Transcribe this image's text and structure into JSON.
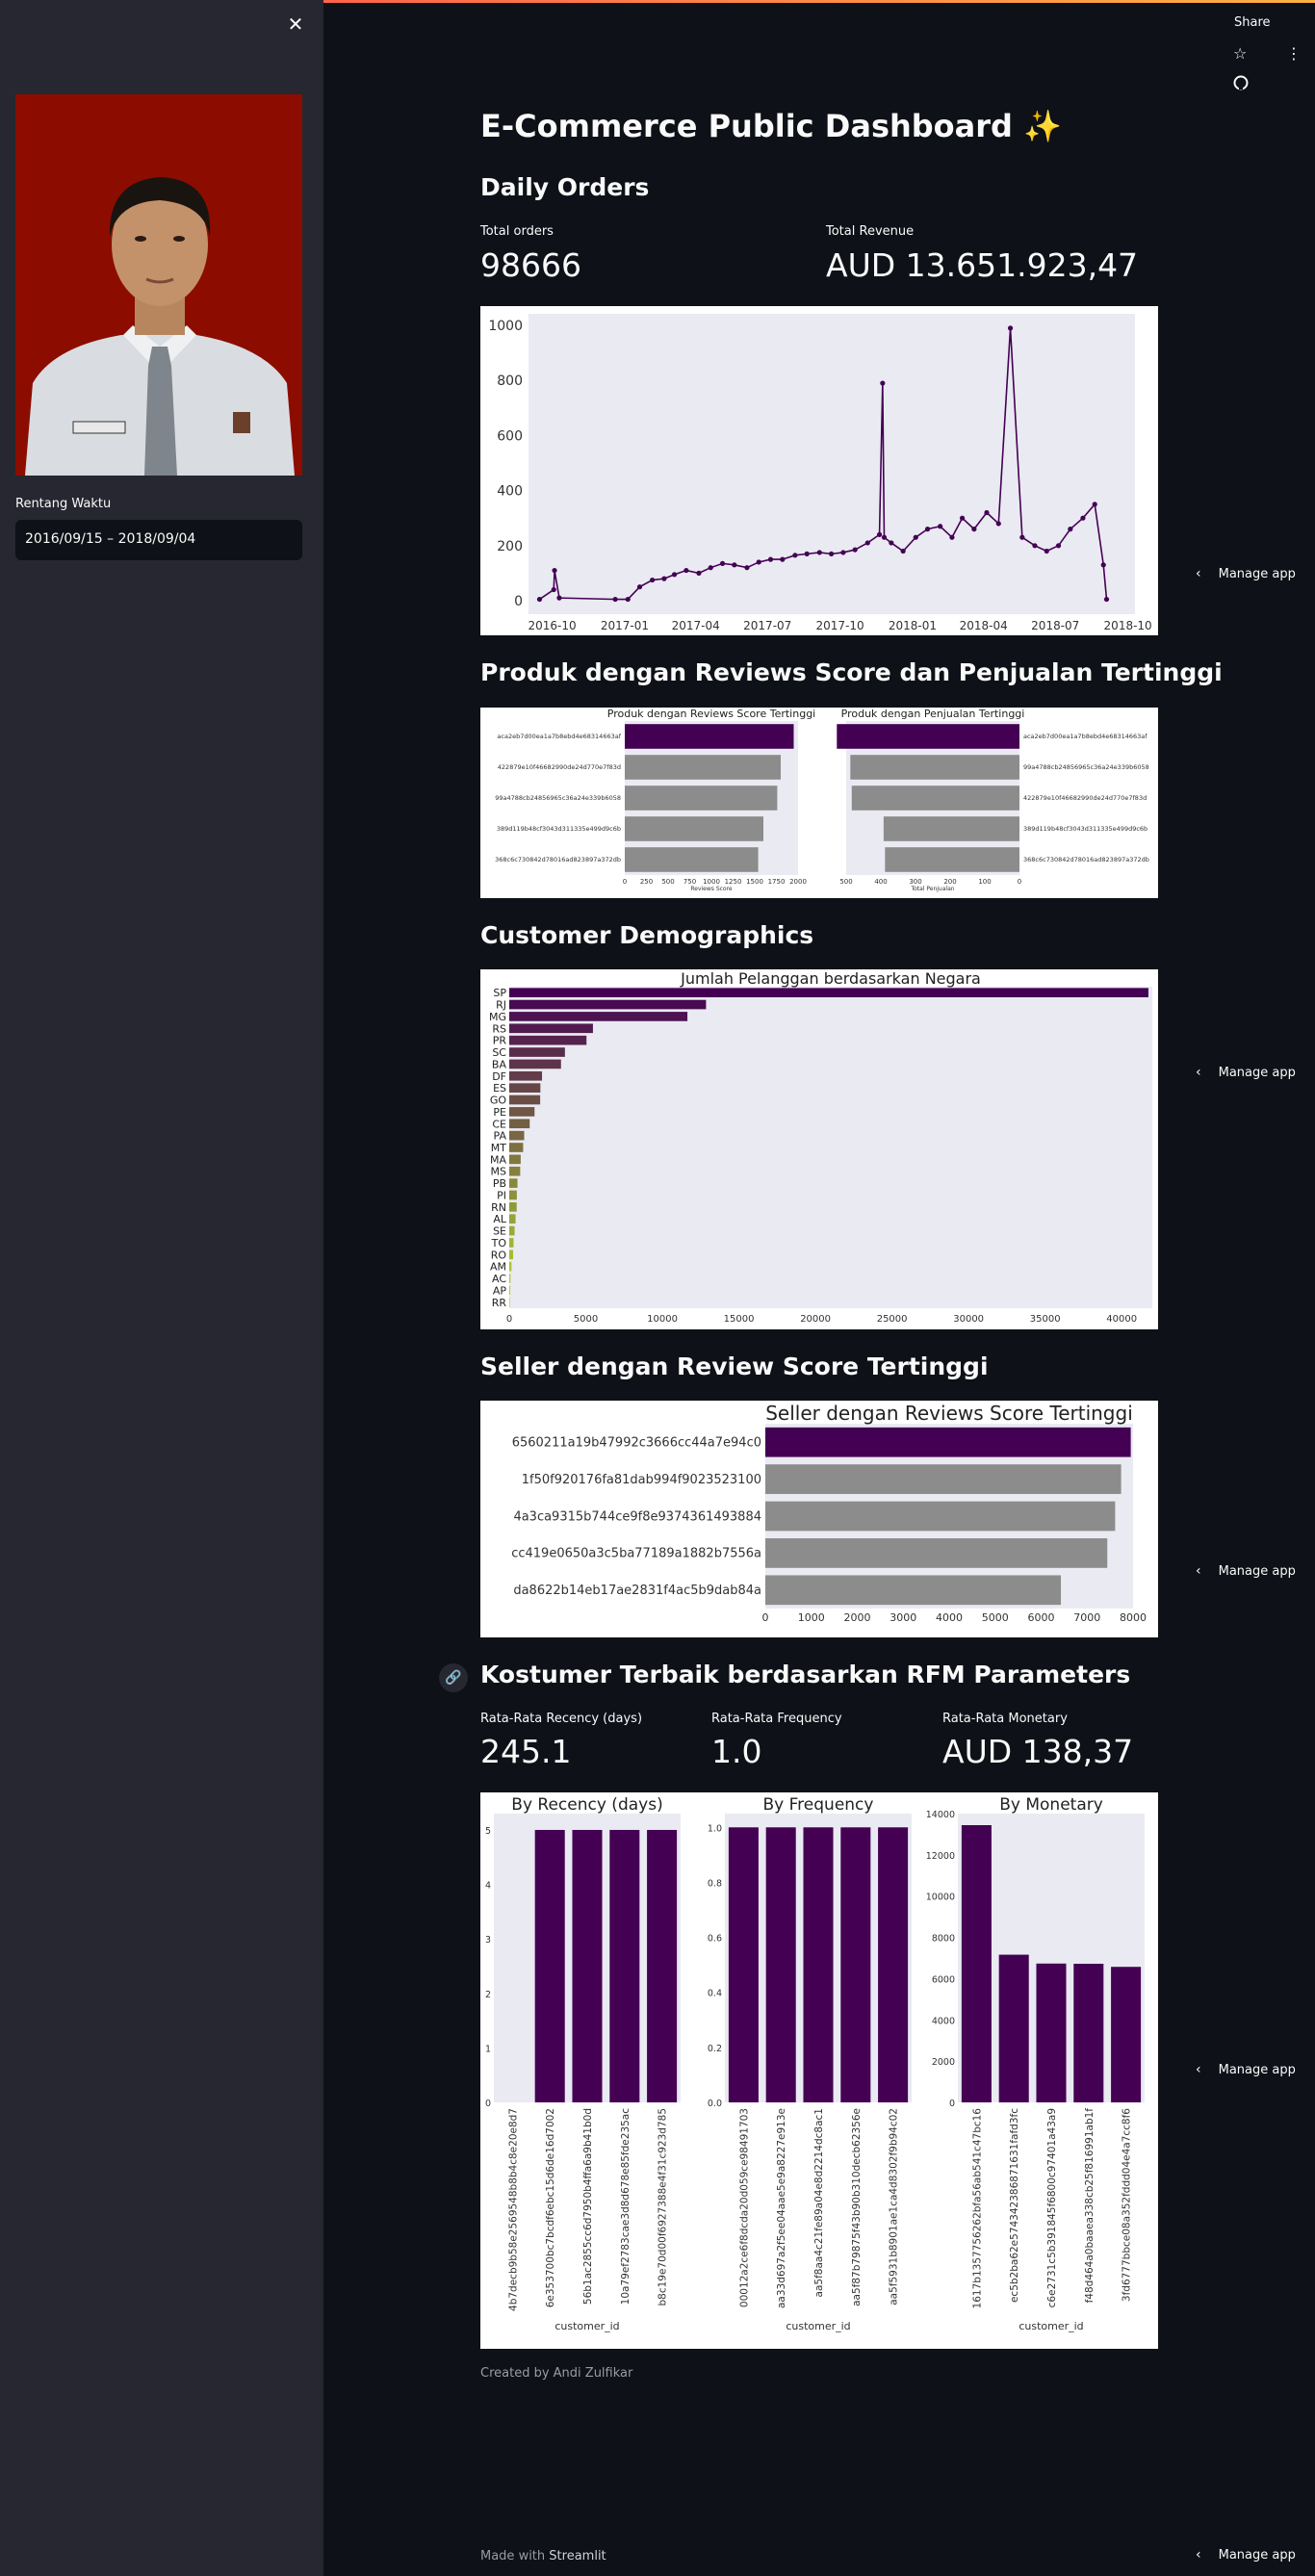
{
  "sidebar": {
    "date_label": "Rentang Waktu",
    "date_value": "2016/09/15 – 2018/09/04"
  },
  "toolbar": {
    "share_label": "Share"
  },
  "icons": {
    "close": "close-icon",
    "star": "star-icon",
    "menu": "kebab-menu-icon",
    "github": "github-icon",
    "chevron": "chevron-left-icon",
    "link": "link-icon"
  },
  "page": {
    "title": "E-Commerce Public Dashboard ✨",
    "sections": {
      "daily_orders": "Daily Orders",
      "produk": "Produk dengan Reviews Score dan Penjualan Tertinggi",
      "demographics": "Customer Demographics",
      "seller": "Seller dengan Review Score Tertinggi",
      "rfm": "Kostumer Terbaik berdasarkan RFM Parameters"
    },
    "metrics": {
      "total_orders_label": "Total orders",
      "total_orders_value": "98666",
      "total_revenue_label": "Total Revenue",
      "total_revenue_value": "AUD 13.651.923,47",
      "recency_label": "Rata-Rata Recency (days)",
      "recency_value": "245.1",
      "frequency_label": "Rata-Rata Frequency",
      "frequency_value": "1.0",
      "monetary_label": "Rata-Rata Monetary",
      "monetary_value": "AUD 138,37"
    },
    "manage_app_label": "Manage app",
    "created_by": "Created by Andi Zulfikar",
    "made_with_prefix": "Made with",
    "made_with_brand": "Streamlit"
  },
  "colors": {
    "background": "#0e1117",
    "sidebar": "#262730",
    "purple": "#440154",
    "gray_bar": "#8c8c8c",
    "accent_top": "#ff4b4b"
  },
  "chart_data": [
    {
      "type": "line",
      "title": "",
      "x_tick_labels": [
        "2016-10",
        "2017-01",
        "2017-04",
        "2017-07",
        "2017-10",
        "2018-01",
        "2018-04",
        "2018-07",
        "2018-10"
      ],
      "y_tick_labels": [
        "0",
        "200",
        "400",
        "600",
        "800",
        "1000"
      ],
      "ylim": [
        0,
        1000
      ],
      "x": [
        "2016-09-15",
        "2016-10-03",
        "2016-10-04",
        "2016-10-10",
        "2016-12-20",
        "2017-01-05",
        "2017-01-20",
        "2017-02-05",
        "2017-02-20",
        "2017-03-05",
        "2017-03-20",
        "2017-04-05",
        "2017-04-20",
        "2017-05-05",
        "2017-05-20",
        "2017-06-05",
        "2017-06-20",
        "2017-07-05",
        "2017-07-20",
        "2017-08-05",
        "2017-08-20",
        "2017-09-05",
        "2017-09-20",
        "2017-10-05",
        "2017-10-20",
        "2017-11-05",
        "2017-11-20",
        "2017-11-24",
        "2017-11-26",
        "2017-12-05",
        "2017-12-20",
        "2018-01-05",
        "2018-01-20",
        "2018-02-05",
        "2018-02-20",
        "2018-03-05",
        "2018-03-20",
        "2018-04-05",
        "2018-04-20",
        "2018-05-05",
        "2018-05-20",
        "2018-06-05",
        "2018-06-20",
        "2018-07-05",
        "2018-07-20",
        "2018-08-05",
        "2018-08-20",
        "2018-08-31",
        "2018-09-04"
      ],
      "values": [
        5,
        40,
        110,
        10,
        5,
        5,
        50,
        75,
        80,
        95,
        110,
        100,
        120,
        135,
        130,
        120,
        140,
        150,
        150,
        165,
        170,
        175,
        170,
        175,
        185,
        210,
        240,
        790,
        230,
        210,
        180,
        230,
        260,
        270,
        230,
        300,
        260,
        320,
        280,
        990,
        230,
        200,
        180,
        200,
        260,
        300,
        350,
        130,
        5
      ],
      "series": [
        {
          "name": "",
          "color": "#440154"
        }
      ]
    },
    {
      "type": "bar",
      "title": "Produk dengan Reviews Score Tertinggi",
      "xlabel": "Reviews Score",
      "orientation": "horizontal",
      "categories": [
        "aca2eb7d00ea1a7b8ebd4e68314663af",
        "422879e10f46682990de24d770e7f83d",
        "99a4788cb24856965c36a24e339b6058",
        "389d119b48cf3043d311335e499d9c6b",
        "368c6c730842d78016ad823897a372db"
      ],
      "values": [
        1950,
        1800,
        1760,
        1600,
        1540
      ],
      "x_tick_labels": [
        "0",
        "250",
        "500",
        "750",
        "1000",
        "1250",
        "1500",
        "1750",
        "2000"
      ],
      "xlim": [
        0,
        2000
      ]
    },
    {
      "type": "bar",
      "title": "Produk dengan Penjualan Tertinggi",
      "xlabel": "Total Penjualan",
      "orientation": "horizontal",
      "categories": [
        "aca2eb7d00ea1a7b8ebd4e68314663af",
        "99a4788cb24856965c36a24e339b6058",
        "422879e10f46682990de24d770e7f83d",
        "389d119b48cf3043d311335e499d9c6b",
        "368c6c730842d78016ad823897a372db"
      ],
      "values": [
        527,
        488,
        484,
        392,
        388
      ],
      "x_tick_labels": [
        "500",
        "400",
        "300",
        "200",
        "100",
        "0"
      ],
      "xlim": [
        0,
        500
      ]
    },
    {
      "type": "bar",
      "title": "Jumlah Pelanggan berdasarkan Negara",
      "orientation": "horizontal",
      "categories": [
        "SP",
        "RJ",
        "MG",
        "RS",
        "PR",
        "SC",
        "BA",
        "DF",
        "ES",
        "GO",
        "PE",
        "CE",
        "PA",
        "MT",
        "MA",
        "MS",
        "PB",
        "PI",
        "RN",
        "AL",
        "SE",
        "TO",
        "RO",
        "AM",
        "AC",
        "AP",
        "RR"
      ],
      "values": [
        41746,
        12852,
        11635,
        5466,
        5045,
        3637,
        3380,
        2140,
        2033,
        2020,
        1652,
        1336,
        975,
        907,
        747,
        715,
        536,
        495,
        485,
        413,
        350,
        280,
        253,
        148,
        81,
        68,
        46
      ],
      "x_tick_labels": [
        "0",
        "5000",
        "10000",
        "15000",
        "20000",
        "25000",
        "30000",
        "35000",
        "40000"
      ],
      "xlim": [
        0,
        42000
      ]
    },
    {
      "type": "bar",
      "title": "Seller dengan Reviews Score Tertinggi",
      "orientation": "horizontal",
      "categories": [
        "6560211a19b47992c3666cc44a7e94c0",
        "1f50f920176fa81dab994f9023523100",
        "4a3ca9315b744ce9f8e9374361493884",
        "cc419e0650a3c5ba77189a1882b7556a",
        "da8622b14eb17ae2831f4ac5b9dab84a"
      ],
      "values": [
        7950,
        7740,
        7610,
        7440,
        6430
      ],
      "x_tick_labels": [
        "0",
        "1000",
        "2000",
        "3000",
        "4000",
        "5000",
        "6000",
        "7000",
        "8000"
      ],
      "xlim": [
        0,
        8000
      ]
    },
    {
      "type": "bar",
      "title": "By Recency (days)",
      "xlabel": "customer_id",
      "categories": [
        "4b7decb9b58e2569548b8b4c8e20e8d7",
        "6e353700bc7bcdf6ebc15d6de16d7002",
        "56b1ac2855cc6d7950b4ffa6a9b41b0d",
        "10a79ef2783cae3d8d678e85fde235ac",
        "b8c19e70d00f6927388e4f31c923d785"
      ],
      "values": [
        0,
        5,
        5,
        5,
        5
      ],
      "y_tick_labels": [
        "0",
        "1",
        "2",
        "3",
        "4",
        "5"
      ],
      "ylim": [
        0,
        5.3
      ]
    },
    {
      "type": "bar",
      "title": "By Frequency",
      "xlabel": "customer_id",
      "categories": [
        "00012a2ce6f8dcda20d059ce98491703",
        "aa33d697a2f5ee04aae5e9a8227e913e",
        "aa5f8aa4c21fe89a04e8d2214dc8ac1",
        "aa5f87b79875f43b90b310decb62356e",
        "aa5f5931b8901ae1ca4d8302f9b94c02"
      ],
      "values": [
        1.0,
        1.0,
        1.0,
        1.0,
        1.0
      ],
      "y_tick_labels": [
        "0.0",
        "0.2",
        "0.4",
        "0.6",
        "0.8",
        "1.0"
      ],
      "ylim": [
        0,
        1.05
      ]
    },
    {
      "type": "bar",
      "title": "By Monetary",
      "xlabel": "customer_id",
      "categories": [
        "1617b1357756262bfa56ab541c47bc16",
        "ec5b2ba62e574342386871631fafd3fc",
        "c6e2731c5b391845f6800c97401a43a9",
        "f48d464a0baaea338cb25f816991ab1f",
        "3fd6777bbce08a352fddd04e4a7cc8f6"
      ],
      "values": [
        13440,
        7160,
        6730,
        6720,
        6570
      ],
      "y_tick_labels": [
        "0",
        "2000",
        "4000",
        "6000",
        "8000",
        "10000",
        "12000",
        "14000"
      ],
      "ylim": [
        0,
        14000
      ]
    }
  ]
}
